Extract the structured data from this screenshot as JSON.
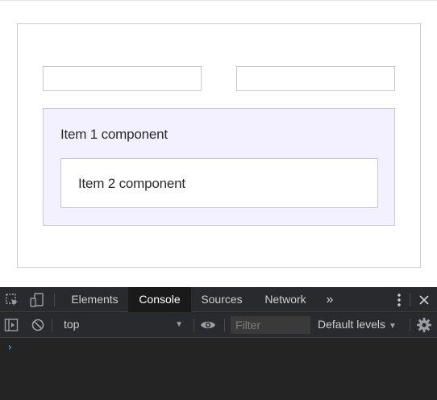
{
  "page": {
    "input_left": {
      "value": "",
      "placeholder": ""
    },
    "input_right": {
      "value": "",
      "placeholder": ""
    },
    "item1_label": "Item 1 component",
    "item2_label": "Item 2 component"
  },
  "devtools": {
    "tabs": [
      {
        "label": "Elements",
        "active": false
      },
      {
        "label": "Console",
        "active": true
      },
      {
        "label": "Sources",
        "active": false
      },
      {
        "label": "Network",
        "active": false
      }
    ],
    "more_tabs_glyph": "»",
    "context": "top",
    "filter_placeholder": "Filter",
    "levels": "Default levels",
    "prompt_glyph": "›",
    "icons": [
      "inspect-element-icon",
      "device-toolbar-icon",
      "more-tabs-icon",
      "kebab-menu-icon",
      "close-icon",
      "sidebar-toggle-icon",
      "clear-console-icon",
      "eye-icon",
      "gear-icon"
    ]
  },
  "colors": {
    "item1_background": "#f3f1ff",
    "devtools_background": "#242424",
    "active_tab": "#1a1a1a",
    "prompt": "#4d9cf8"
  }
}
